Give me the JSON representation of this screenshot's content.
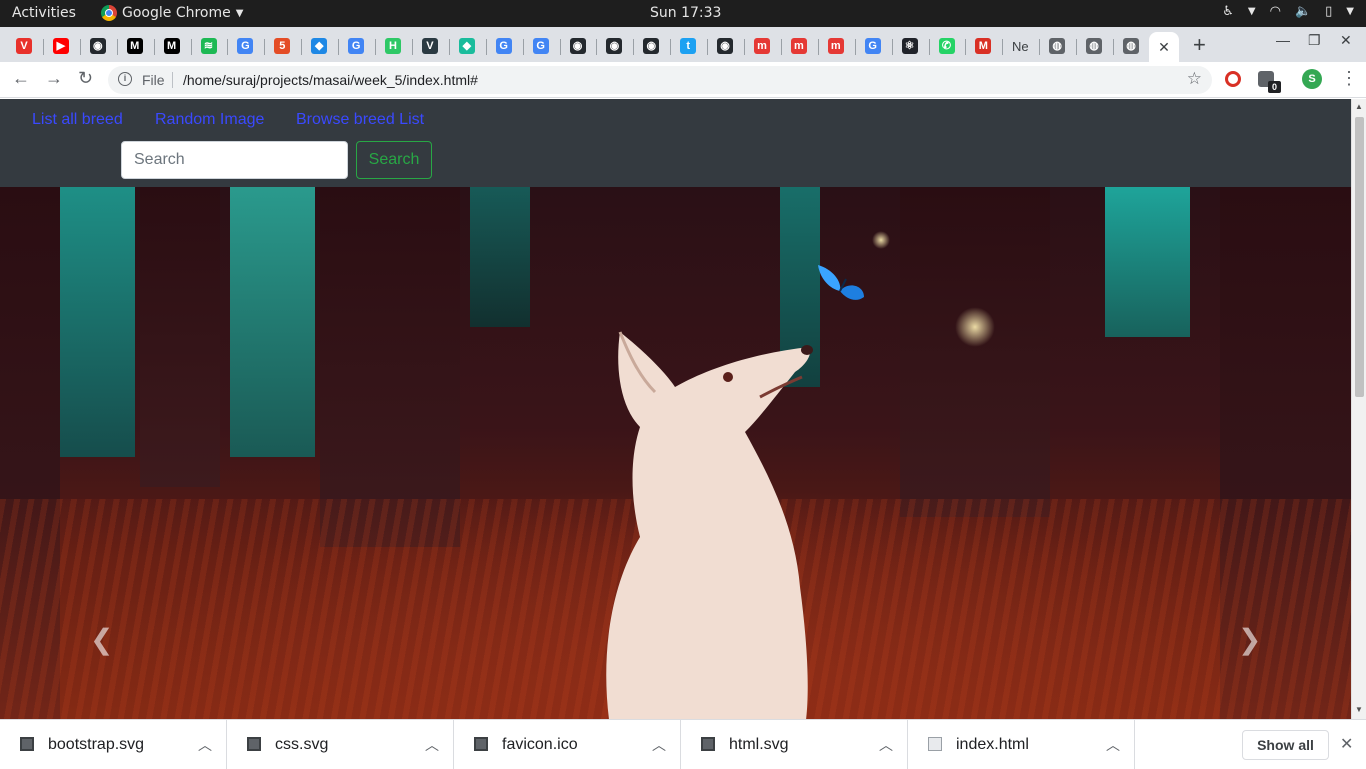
{
  "os_bar": {
    "activities": "Activities",
    "app_name": "Google Chrome",
    "clock": "Sun 17:33"
  },
  "tabs": [
    {
      "icon": "vivaldi-icon",
      "glyph": "V",
      "color": "#e8312b"
    },
    {
      "icon": "youtube-icon",
      "glyph": "▶",
      "color": "#ff0000"
    },
    {
      "icon": "github-icon",
      "glyph": "◉",
      "color": "#24292e"
    },
    {
      "icon": "medium-icon",
      "glyph": "M",
      "color": "#000000"
    },
    {
      "icon": "medium-icon",
      "glyph": "M",
      "color": "#000000"
    },
    {
      "icon": "spotify-icon",
      "glyph": "≋",
      "color": "#1db954"
    },
    {
      "icon": "google-icon",
      "glyph": "G",
      "color": "#4285f4"
    },
    {
      "icon": "html5-icon",
      "glyph": "5",
      "color": "#e44d26"
    },
    {
      "icon": "bird-icon",
      "glyph": "◆",
      "color": "#1e88e5"
    },
    {
      "icon": "google-icon",
      "glyph": "G",
      "color": "#4285f4"
    },
    {
      "icon": "hackerrank-icon",
      "glyph": "H",
      "color": "#2ec866"
    },
    {
      "icon": "vue-icon",
      "glyph": "V",
      "color": "#2b3a42"
    },
    {
      "icon": "diamond-icon",
      "glyph": "◆",
      "color": "#1abc9c"
    },
    {
      "icon": "google-icon",
      "glyph": "G",
      "color": "#4285f4"
    },
    {
      "icon": "google-icon",
      "glyph": "G",
      "color": "#4285f4"
    },
    {
      "icon": "github-icon",
      "glyph": "◉",
      "color": "#24292e"
    },
    {
      "icon": "github-icon",
      "glyph": "◉",
      "color": "#24292e"
    },
    {
      "icon": "github-icon",
      "glyph": "◉",
      "color": "#24292e"
    },
    {
      "icon": "twitter-icon",
      "glyph": "t",
      "color": "#1da1f2"
    },
    {
      "icon": "github-icon",
      "glyph": "◉",
      "color": "#24292e"
    },
    {
      "icon": "masai-icon",
      "glyph": "m",
      "color": "#e53935"
    },
    {
      "icon": "masai-icon",
      "glyph": "m",
      "color": "#e53935"
    },
    {
      "icon": "masai-icon",
      "glyph": "m",
      "color": "#e53935"
    },
    {
      "icon": "google-icon",
      "glyph": "G",
      "color": "#4285f4"
    },
    {
      "icon": "react-icon",
      "glyph": "⚛",
      "color": "#20232a"
    },
    {
      "icon": "whatsapp-icon",
      "glyph": "✆",
      "color": "#25d366"
    },
    {
      "icon": "gmail-icon",
      "glyph": "M",
      "color": "#d93025"
    },
    {
      "icon": "netflix-tab",
      "glyph": "Ne",
      "color": "#ffffff"
    },
    {
      "icon": "globe-icon",
      "glyph": "◍",
      "color": "#5f6368"
    },
    {
      "icon": "globe-icon",
      "glyph": "◍",
      "color": "#5f6368"
    },
    {
      "icon": "globe-icon",
      "glyph": "◍",
      "color": "#5f6368"
    }
  ],
  "addressbar": {
    "scheme": "File",
    "url": "/home/suraj/projects/masai/week_5/index.html#"
  },
  "extensions": {
    "badge_count": "0",
    "profile_initial": "S"
  },
  "site": {
    "nav": [
      "List all breed",
      "Random Image",
      "Browse breed List"
    ],
    "search_placeholder": "Search",
    "search_button": "Search",
    "link_color": "#3a49ff",
    "navbar_color": "#343a40",
    "success_color": "#28a745"
  },
  "downloads": {
    "items": [
      "bootstrap.svg",
      "css.svg",
      "favicon.ico",
      "html.svg",
      "index.html"
    ],
    "show_all": "Show all"
  }
}
